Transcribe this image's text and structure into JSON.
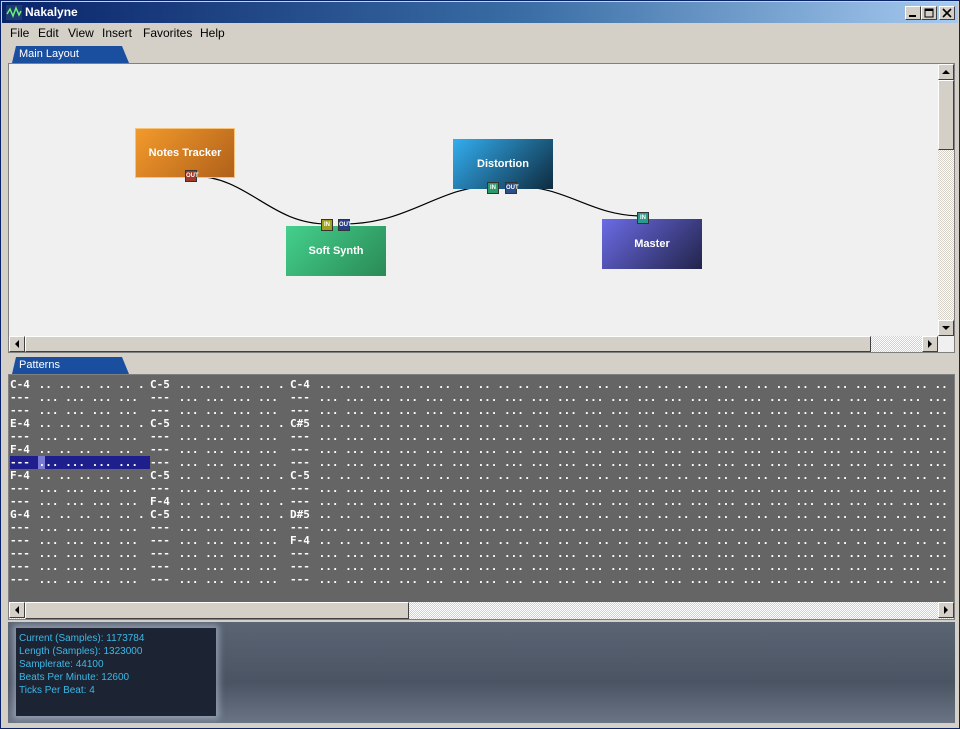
{
  "window": {
    "title": "Nakalyne"
  },
  "menu": [
    "File",
    "Edit",
    "View",
    "Insert",
    "Favorites",
    "Help"
  ],
  "tabs": {
    "layout": "Main Layout",
    "patterns": "Patterns"
  },
  "nodes": {
    "notes_tracker": {
      "label": "Notes Tracker",
      "color_from": "#f39a2c",
      "color_to": "#b0611a"
    },
    "soft_synth": {
      "label": "Soft Synth",
      "color_from": "#44d08d",
      "color_to": "#2a8a55"
    },
    "distortion": {
      "label": "Distortion",
      "color_from": "#33aef0",
      "color_to": "#0e2b3f"
    },
    "master": {
      "label": "Master",
      "color_from": "#6b6be6",
      "color_to": "#22244a"
    }
  },
  "ports": {
    "in": "IN",
    "out": "OUT"
  },
  "patterns": {
    "columns": [
      [
        "C-4",
        "---",
        "---",
        "E-4",
        "---",
        "F-4",
        "---",
        "F-4",
        "---",
        "---",
        "G-4",
        "---",
        "---",
        "---",
        "---",
        "---"
      ],
      [
        "C-5",
        "---",
        "---",
        "C-5",
        "---",
        "---",
        "---",
        "C-5",
        "---",
        "F-4",
        "C-5",
        "---",
        "---",
        "---",
        "---",
        "---"
      ],
      [
        "C-4",
        "---",
        "---",
        "C#5",
        "---",
        "---",
        "---",
        "C-5",
        "---",
        "---",
        "D#5",
        "---",
        "F-4",
        "---",
        "---",
        "---"
      ]
    ]
  },
  "info": {
    "current": "Current (Samples): 1173784",
    "length": "Length (Samples): 1323000",
    "samplerate": "Samplerate: 44100",
    "bpm": "Beats Per Minute: 12600",
    "ticks": "Ticks Per Beat: 4"
  }
}
